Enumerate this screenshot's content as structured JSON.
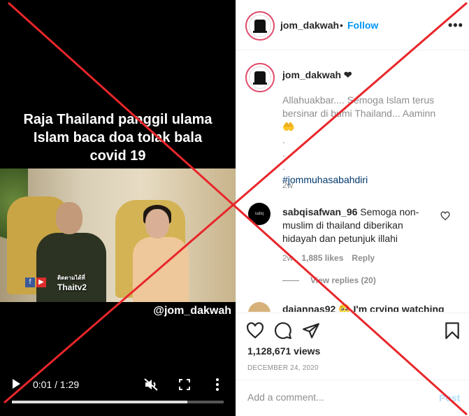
{
  "video": {
    "caption": "Raja Thailand panggil ulama\nIslam baca doa tolak bala\ncovid 19",
    "channel_small": "ติดตามได้ที่",
    "channel": "Thaitv2",
    "watermark": "@jom_dakwah",
    "time": "0:01 / 1:29",
    "progress": 0.83
  },
  "header": {
    "username": "jom_dakwah",
    "separator": "•",
    "follow_label": "Follow",
    "more_label": "•••"
  },
  "caption": {
    "username": "jom_dakwah ❤",
    "text": "Allahuakbar.... Semoga Islam terus bersinar di bumi Thailand... Aaminn 🤲\n.\n.\n.",
    "hashtag": "#jommuhasabahdiri",
    "time": "2w"
  },
  "comment": {
    "avatar_text": "sabq",
    "username": "sabqisafwan_96",
    "text": "Semoga non-muslim di thailand diberikan hidayah dan petunjuk illahi",
    "time": "2w",
    "likes": "1,885 likes",
    "reply": "Reply",
    "view_replies": "View replies (20)"
  },
  "comment2": {
    "text": "dajannas92 🥺 I'm crying watching"
  },
  "actions": {
    "views": "1,128,671 views",
    "date": "DECEMBER 24, 2020"
  },
  "add_comment": {
    "placeholder": "Add a comment...",
    "post_label": "Post"
  },
  "icons": [
    "play-icon",
    "mute-icon",
    "fullscreen-icon",
    "more-icon",
    "heart-icon",
    "comment-icon",
    "share-icon",
    "bookmark-icon"
  ],
  "colors": {
    "accent": "#0095f6",
    "cross": "#e8262a",
    "muted": "#8e8e8e"
  }
}
